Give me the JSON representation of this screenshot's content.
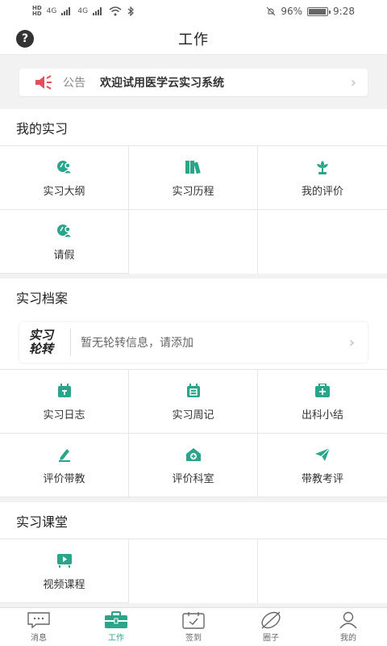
{
  "status": {
    "sim1": "HD",
    "sim2": "HD",
    "net1": "4G",
    "net2": "4G",
    "battery_pct": "96%",
    "time": "9:28"
  },
  "header": {
    "title": "工作",
    "help_glyph": "?"
  },
  "notice": {
    "tag": "公告",
    "message": "欢迎试用医学云实习系统",
    "chevron": "›"
  },
  "sections": {
    "my_internship": {
      "title": "我的实习",
      "items": [
        {
          "label": "实习大纲",
          "icon": "user-badge-icon"
        },
        {
          "label": "实习历程",
          "icon": "books-icon"
        },
        {
          "label": "我的评价",
          "icon": "flower-icon"
        },
        {
          "label": "请假",
          "icon": "user-badge-icon"
        }
      ]
    },
    "archive": {
      "title": "实习档案",
      "rotation_logo_line1": "实习",
      "rotation_logo_line2": "轮转",
      "rotation_text": "暂无轮转信息，请添加",
      "items": [
        {
          "label": "实习日志",
          "icon": "calendar-icon"
        },
        {
          "label": "实习周记",
          "icon": "calendar-week-icon"
        },
        {
          "label": "出科小结",
          "icon": "medical-kit-icon"
        },
        {
          "label": "评价带教",
          "icon": "pen-icon"
        },
        {
          "label": "评价科室",
          "icon": "hospital-icon"
        },
        {
          "label": "带教考评",
          "icon": "paper-plane-icon"
        }
      ]
    },
    "classroom": {
      "title": "实习课堂",
      "items": [
        {
          "label": "视频课程",
          "icon": "video-icon"
        }
      ]
    }
  },
  "tabbar": [
    {
      "label": "消息",
      "icon": "message-icon",
      "active": false
    },
    {
      "label": "工作",
      "icon": "briefcase-icon",
      "active": true
    },
    {
      "label": "签到",
      "icon": "checkin-icon",
      "active": false
    },
    {
      "label": "圈子",
      "icon": "leaf-icon",
      "active": false
    },
    {
      "label": "我的",
      "icon": "person-icon",
      "active": false
    }
  ],
  "colors": {
    "accent": "#2aa58b",
    "speaker": "#e84b5a"
  }
}
